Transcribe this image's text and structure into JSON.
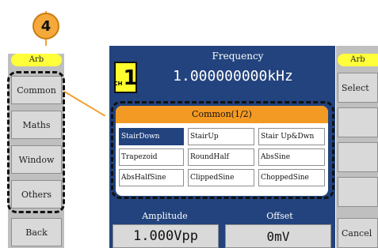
{
  "callout": {
    "number": "4"
  },
  "left_softkeys": {
    "mode_label": "Arb",
    "items": [
      "Common",
      "Maths",
      "Window",
      "Others",
      "Back"
    ]
  },
  "channel": {
    "prefix": "CH",
    "number": "1"
  },
  "frequency": {
    "label": "Frequency",
    "value": "1.000000000kHz"
  },
  "menu": {
    "title": "Common(1/2)",
    "items": [
      "StairDown",
      "StairUp",
      "Stair Up&Dwn",
      "Trapezoid",
      "RoundHalf",
      "AbsSine",
      "AbsHalfSine",
      "ClippedSine",
      "ChoppedSine"
    ],
    "selected": "StairDown"
  },
  "amplitude": {
    "label": "Amplitude",
    "value": "1.000Vpp"
  },
  "offset": {
    "label": "Offset",
    "value": "0mV"
  },
  "right_softkeys": {
    "mode_label": "Arb",
    "items": [
      "Select",
      "",
      "",
      "",
      "Cancel"
    ]
  },
  "colors": {
    "screen_bg": "#22437d",
    "accent_orange": "#f39a24",
    "highlight_yellow": "#ffff3a",
    "softkey_gray": "#d9d9d9"
  }
}
